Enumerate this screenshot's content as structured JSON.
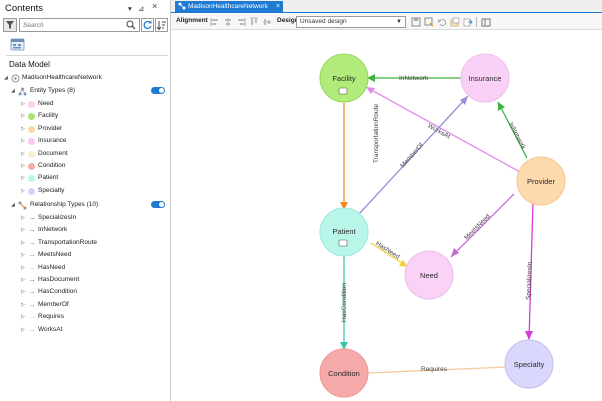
{
  "contents": {
    "title": "Contents",
    "search_placeholder": "Search",
    "data_model_label": "Data Model",
    "network_name": "MadisonHealthcareNetwork",
    "entity_types_header": "Entity Types (8)",
    "relationship_types_header": "Relationship Types (10)",
    "entity_types": [
      {
        "label": "Need",
        "color": "#f9d1f5"
      },
      {
        "label": "Facility",
        "color": "#a9e56b"
      },
      {
        "label": "Provider",
        "color": "#fcd9a9"
      },
      {
        "label": "Insurance",
        "color": "#f9c9f3"
      },
      {
        "label": "Document",
        "color": "#f9f0cc"
      },
      {
        "label": "Condition",
        "color": "#f7a9a9"
      },
      {
        "label": "Patient",
        "color": "#b5f7e9"
      },
      {
        "label": "Specialty",
        "color": "#d6d3f7"
      }
    ],
    "relationship_types": [
      {
        "label": "SpecializesIn",
        "color": "#d83ad8"
      },
      {
        "label": "InNetwork",
        "color": "#3fb33f"
      },
      {
        "label": "TransportationRoute",
        "color": "#f08a1e"
      },
      {
        "label": "MeetsNeed",
        "color": "#c06ad0"
      },
      {
        "label": "HasNeed",
        "color": "#f0d040"
      },
      {
        "label": "HasDocument",
        "color": "#e04a70"
      },
      {
        "label": "HasCondition",
        "color": "#3fc3a8"
      },
      {
        "label": "MemberOf",
        "color": "#9a8ad8"
      },
      {
        "label": "Requires",
        "color": "#f5c9a0"
      },
      {
        "label": "WorksAt",
        "color": "#e48ae8"
      }
    ]
  },
  "editor": {
    "tab_label": "MadisonHealthcareNetwork",
    "alignment_label": "Alignment",
    "design_label": "Design",
    "design_value": "Unsaved design"
  },
  "graph": {
    "nodes": {
      "facility": {
        "label": "Facility",
        "color": "#b1ec7a",
        "stroke": "#96d661"
      },
      "insurance": {
        "label": "Insurance",
        "color": "#f9d1f6",
        "stroke": "#f0bcec"
      },
      "provider": {
        "label": "Provider",
        "color": "#fdd9ae",
        "stroke": "#f5c690"
      },
      "patient": {
        "label": "Patient",
        "color": "#b9f6ea",
        "stroke": "#9ee8d9"
      },
      "need": {
        "label": "Need",
        "color": "#f9d2f5",
        "stroke": "#eebde9"
      },
      "condition": {
        "label": "Condition",
        "color": "#f7aaaa",
        "stroke": "#ee9494"
      },
      "specialty": {
        "label": "Specialty",
        "color": "#d9d7fb",
        "stroke": "#c3c0f0"
      }
    },
    "edges": {
      "in_network_1": {
        "label": "InNetwork",
        "color": "#3fb33f"
      },
      "in_network_2": {
        "label": "InNetwork",
        "color": "#3fb33f"
      },
      "works_at": {
        "label": "WorksAt",
        "color": "#e48ae8"
      },
      "member_of": {
        "label": "MemberOf",
        "color": "#9a8ad8"
      },
      "transportation_route": {
        "label": "TransportationRoute",
        "color": "#f08a1e"
      },
      "meets_need": {
        "label": "MeetsNeed",
        "color": "#c06ad0"
      },
      "has_need": {
        "label": "HasNeed",
        "color": "#f0d040"
      },
      "specializes_in": {
        "label": "SpecializesIn",
        "color": "#d83ad8"
      },
      "has_condition": {
        "label": "HasCondition",
        "color": "#3fc3a8"
      },
      "requires": {
        "label": "Requires",
        "color": "#f5c9a0"
      }
    }
  }
}
